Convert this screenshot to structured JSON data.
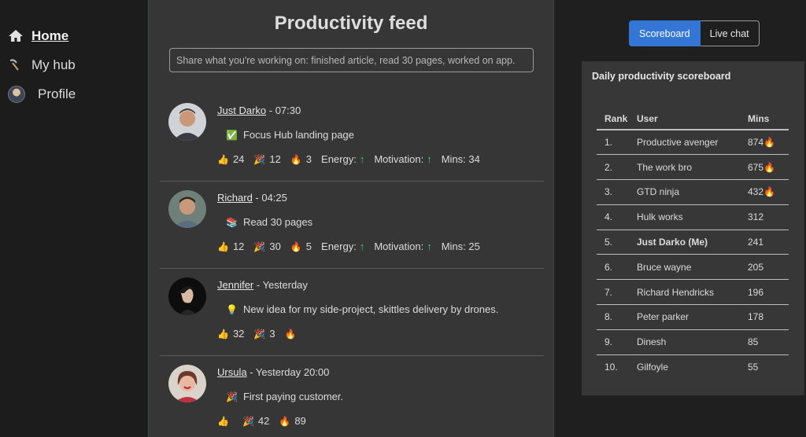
{
  "sidebar": {
    "items": [
      {
        "label": "Home",
        "icon": "home-icon",
        "active": true
      },
      {
        "label": "My hub",
        "icon": "pickaxe-icon"
      },
      {
        "label": "Profile",
        "icon": "avatar"
      }
    ]
  },
  "feed": {
    "title": "Productivity feed",
    "placeholder": "Share what you're working on: finished article, read 30 pages, worked on app.",
    "posts": [
      {
        "name": "Just Darko",
        "time": " - 07:30",
        "emoji": "✅",
        "text": "Focus Hub landing page",
        "likes": "24",
        "party": "12",
        "fire": "3",
        "energy": "Energy:",
        "motivation": "Motivation:",
        "mins": "Mins: 34"
      },
      {
        "name": "Richard",
        "time": " - 04:25",
        "emoji": "📚",
        "text": "Read 30 pages",
        "likes": "12",
        "party": "30",
        "fire": "5",
        "energy": "Energy:",
        "motivation": "Motivation:",
        "mins": "Mins: 25"
      },
      {
        "name": "Jennifer",
        "time": " - Yesterday",
        "emoji": "💡",
        "text": "New idea for my side-project, skittles delivery by drones.",
        "likes": "32",
        "party": "3",
        "fire": ""
      },
      {
        "name": "Ursula",
        "time": " - Yesterday 20:00",
        "emoji": "🎉",
        "text": "First paying customer.",
        "likes": "",
        "party": "42",
        "fire": "89"
      }
    ]
  },
  "tabs": {
    "scoreboard": "Scoreboard",
    "live_chat": "Live chat"
  },
  "scoreboard": {
    "title": "Daily productivity scoreboard",
    "headers": {
      "rank": "Rank",
      "user": "User",
      "mins": "Mins"
    },
    "rows": [
      {
        "rank": "1.",
        "user": "Productive avenger",
        "mins": "874🔥"
      },
      {
        "rank": "2.",
        "user": "The work bro",
        "mins": "675🔥"
      },
      {
        "rank": "3.",
        "user": "GTD ninja",
        "mins": "432🔥"
      },
      {
        "rank": "4.",
        "user": "Hulk works",
        "mins": "312"
      },
      {
        "rank": "5.",
        "user": "Just Darko (Me)",
        "mins": "241"
      },
      {
        "rank": "6.",
        "user": "Bruce wayne",
        "mins": "205"
      },
      {
        "rank": "7.",
        "user": "Richard Hendricks",
        "mins": "196"
      },
      {
        "rank": "8.",
        "user": "Peter parker",
        "mins": "178"
      },
      {
        "rank": "9.",
        "user": "Dinesh",
        "mins": "85"
      },
      {
        "rank": "10.",
        "user": "Gilfoyle",
        "mins": "55"
      }
    ]
  },
  "colors": {
    "accent": "#3376d6",
    "arrow": "#2fcf7a",
    "feed_bg": "#363636"
  }
}
